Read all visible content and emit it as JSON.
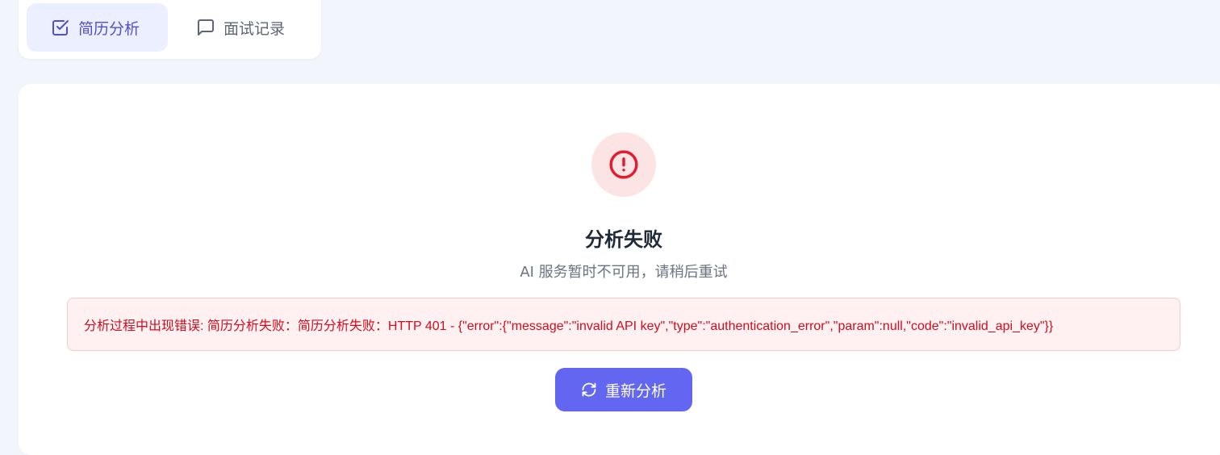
{
  "tabs": [
    {
      "label": "简历分析",
      "icon": "checkbox-icon",
      "active": true
    },
    {
      "label": "面试记录",
      "icon": "chat-bubble-icon",
      "active": false
    }
  ],
  "error_state": {
    "icon": "alert-circle-icon",
    "title": "分析失败",
    "subtitle": "AI 服务暂时不可用，请稍后重试",
    "detail": "分析过程中出现错误: 简历分析失败：简历分析失败：HTTP 401 - {\"error\":{\"message\":\"invalid API key\",\"type\":\"authentication_error\",\"param\":null,\"code\":\"invalid_api_key\"}}",
    "retry_label": "重新分析",
    "retry_icon": "refresh-icon"
  },
  "colors": {
    "accent": "#6366f1",
    "error": "#e11d2e",
    "error_bg": "#fde4e4"
  }
}
